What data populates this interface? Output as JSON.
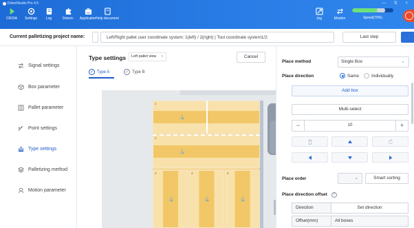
{
  "app": {
    "title": "DobotStudio Pro 4.5"
  },
  "window_controls": "— ⇅ ×",
  "toolbar": {
    "items": [
      {
        "label": "CR20A",
        "icon": "robot-play-icon"
      },
      {
        "label": "Settings",
        "icon": "settings-icon"
      },
      {
        "label": "Log",
        "icon": "log-icon"
      },
      {
        "label": "Dobot+",
        "icon": "puzzle-icon"
      },
      {
        "label": "Application",
        "icon": "application-icon"
      },
      {
        "label": "Help document",
        "icon": "help-document-icon"
      },
      {
        "label": "Jog",
        "icon": "jog-icon"
      },
      {
        "label": "Monitor",
        "icon": "monitor-icon"
      }
    ],
    "speed": {
      "label": "Speed(70%)",
      "value": 0.7
    },
    "colors": {
      "toolbar_bg": "#2a7de6",
      "speed_fill": "#6fe07a",
      "estop": "#e84b2f"
    }
  },
  "project": {
    "label": "Current palletizing project name:",
    "name": "",
    "info": "Left/Right pallet user coordinate system: 1(left) / 2(right) | Tool coordinate system1/2:",
    "last_step": "Last step",
    "next_step": ""
  },
  "sidebar": {
    "items": [
      {
        "label": "Signal settings",
        "icon": "signal-settings-icon",
        "active": false
      },
      {
        "label": "Box parameter",
        "icon": "box-icon",
        "active": false
      },
      {
        "label": "Pallet parameter",
        "icon": "pallet-icon",
        "active": false
      },
      {
        "label": "Point settings",
        "icon": "point-settings-icon",
        "active": false
      },
      {
        "label": "Type settings",
        "icon": "type-settings-icon",
        "active": true
      },
      {
        "label": "Palletizing method",
        "icon": "palletizing-method-icon",
        "active": false
      },
      {
        "label": "Motion parameter",
        "icon": "motion-parameter-icon",
        "active": false
      }
    ]
  },
  "main": {
    "title": "Type settings",
    "view_select": "Left pallet view",
    "cancel": "Cancel",
    "types": [
      {
        "label": "Type A",
        "active": true
      },
      {
        "label": "Type B",
        "active": false
      }
    ],
    "cells": [
      "1",
      "2",
      "3",
      "4",
      "5"
    ]
  },
  "right_panel": {
    "place_method": {
      "label": "Place method",
      "value": "Single Box"
    },
    "place_direction": {
      "label": "Place direction",
      "options": [
        "Same",
        "Individually"
      ],
      "selected": "Same"
    },
    "add_box": "Add box",
    "multi_select": "Multi-select",
    "stepper": {
      "minus": "−",
      "value": "10",
      "plus": "+"
    },
    "place_order": {
      "label": "Place order",
      "value": "",
      "smart_sorting": "Smart sorting"
    },
    "place_direction_offset": {
      "label": "Place direction offset",
      "help": "?"
    },
    "direction": {
      "label": "Direction",
      "value": "Set direction"
    },
    "offset": {
      "label": "Offset(mm)",
      "value": "All boxes"
    }
  }
}
